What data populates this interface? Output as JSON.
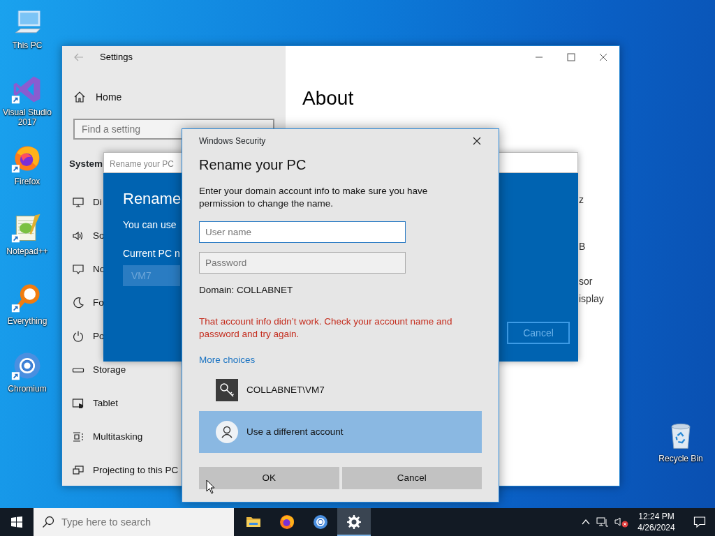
{
  "desktop_icons": [
    {
      "label": "This PC",
      "kind": "pc"
    },
    {
      "label": "Visual Studio 2017",
      "kind": "vs"
    },
    {
      "label": "Firefox",
      "kind": "firefox"
    },
    {
      "label": "Notepad++",
      "kind": "notepad"
    },
    {
      "label": "Everything",
      "kind": "everything"
    },
    {
      "label": "Chromium",
      "kind": "chromium"
    },
    {
      "label": "Recycle Bin",
      "kind": "bin"
    }
  ],
  "settings_window": {
    "title": "Settings",
    "home": "Home",
    "search": {
      "placeholder": "Find a setting"
    },
    "section": "System",
    "items": [
      {
        "label": "Di",
        "kind": "display"
      },
      {
        "label": "So",
        "kind": "sound"
      },
      {
        "label": "No",
        "kind": "notifications"
      },
      {
        "label": "Fo",
        "kind": "focus"
      },
      {
        "label": "Po",
        "kind": "power"
      },
      {
        "label": "Storage",
        "kind": "storage"
      },
      {
        "label": "Tablet",
        "kind": "tablet"
      },
      {
        "label": "Multitasking",
        "kind": "multitasking"
      },
      {
        "label": "Projecting to this PC",
        "kind": "projecting"
      }
    ],
    "page_title": "About",
    "page_fragments": [
      "z",
      "B",
      "sor",
      "isplay"
    ]
  },
  "rename_dialog": {
    "title": "Rename your PC",
    "heading": "Rename",
    "text": "You can use",
    "field_label": "Current PC n",
    "field_value": "VM7",
    "button": "Cancel"
  },
  "security_dialog": {
    "app": "Windows Security",
    "title": "Rename your PC",
    "message": "Enter your domain account info to make sure you have permission to change the name.",
    "username": {
      "placeholder": "User name"
    },
    "password": {
      "placeholder": "Password"
    },
    "domain": "Domain: COLLABNET",
    "error": "That account info didn’t work. Check your account name and password and try again.",
    "more_choices": "More choices",
    "accounts": [
      {
        "label": "COLLABNET\\VM7",
        "kind": "key",
        "selected": false
      },
      {
        "label": "Use a different account",
        "kind": "user",
        "selected": true
      }
    ],
    "buttons": [
      "OK",
      "Cancel"
    ]
  },
  "taskbar": {
    "search": {
      "placeholder": "Type here to search"
    },
    "apps": [
      {
        "kind": "folder",
        "selected": false
      },
      {
        "kind": "firefox",
        "selected": false
      },
      {
        "kind": "chromium",
        "selected": false
      },
      {
        "kind": "settings",
        "selected": true
      }
    ],
    "time": "12:24 PM",
    "date": "4/26/2024"
  }
}
